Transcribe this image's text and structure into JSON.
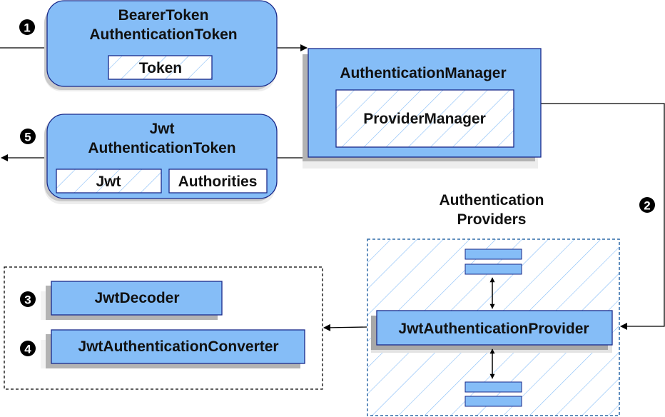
{
  "colors": {
    "box_fill": "#85bdf7",
    "box_stroke": "#1a2a8a",
    "shadow": "#b3b3b3",
    "shadow_light": "#ededed",
    "hatch": "#85bdf7",
    "dashed_blue": "#2e6aa8",
    "dashed_black": "#000000",
    "line": "#000000"
  },
  "nodes": {
    "bearer_token": {
      "title_line1": "BearerToken",
      "title_line2": "AuthenticationToken",
      "field": "Token"
    },
    "jwt_token": {
      "title_line1": "Jwt",
      "title_line2": "AuthenticationToken",
      "field1": "Jwt",
      "field2": "Authorities"
    },
    "auth_manager": {
      "title": "AuthenticationManager",
      "inner": "ProviderManager"
    },
    "providers_group": {
      "title_line1": "Authentication",
      "title_line2": "Providers",
      "provider": "JwtAuthenticationProvider"
    },
    "components": {
      "decoder": "JwtDecoder",
      "converter": "JwtAuthenticationConverter"
    }
  },
  "steps": {
    "s1": "1",
    "s2": "2",
    "s3": "3",
    "s4": "4",
    "s5": "5"
  }
}
